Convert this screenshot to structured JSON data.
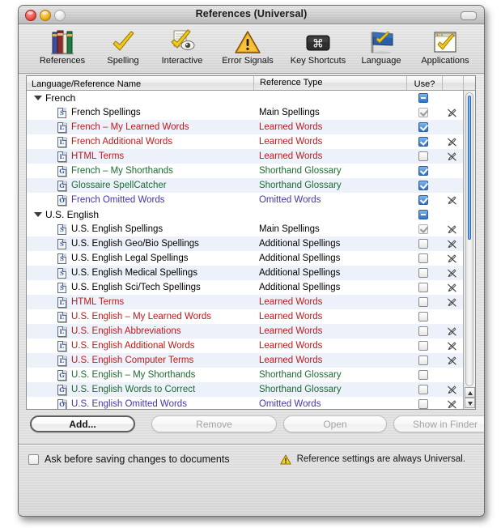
{
  "window": {
    "title": "References (Universal)",
    "controls": {
      "close": "close-button",
      "minimize": "minimize-button",
      "zoom": "zoom-button"
    }
  },
  "toolbar": {
    "items": [
      {
        "label": "References",
        "icon": "books-icon"
      },
      {
        "label": "Spelling",
        "icon": "checkmark-icon"
      },
      {
        "label": "Interactive",
        "icon": "eye-checkmark-icon"
      },
      {
        "label": "Error Signals",
        "icon": "warning-triangle-icon"
      },
      {
        "label": "Key Shortcuts",
        "icon": "command-key-icon"
      },
      {
        "label": "Language",
        "icon": "flag-icon"
      },
      {
        "label": "Applications",
        "icon": "window-checkmark-icon"
      }
    ]
  },
  "table": {
    "columns": [
      "Language/Reference Name",
      "Reference Type",
      "Use?",
      "",
      ""
    ],
    "groups": [
      {
        "name": "French",
        "expanded": true,
        "use_state": "mixed",
        "rows": [
          {
            "name": "French Spellings",
            "type": "Main Spellings",
            "color": "#000000",
            "icon": "S",
            "use": "dim-checked",
            "edit": true
          },
          {
            "name": "French – My Learned Words",
            "type": "Learned Words",
            "color": "#c0191b",
            "icon": "L",
            "use": "checked",
            "edit": false
          },
          {
            "name": "French Additional Words",
            "type": "Learned Words",
            "color": "#c0191b",
            "icon": "L",
            "use": "checked",
            "edit": true
          },
          {
            "name": "HTML Terms",
            "type": "Learned Words",
            "color": "#c0191b",
            "icon": "L",
            "use": "unchecked",
            "edit": true
          },
          {
            "name": "French – My Shorthands",
            "type": "Shorthand Glossary",
            "color": "#1d6b33",
            "icon": "G",
            "use": "checked",
            "edit": false
          },
          {
            "name": "Glossaire SpellCatcher",
            "type": "Shorthand Glossary",
            "color": "#1d6b33",
            "icon": "G",
            "use": "checked",
            "edit": false
          },
          {
            "name": "French Omitted Words",
            "type": "Omitted Words",
            "color": "#4535a8",
            "icon": "O",
            "use": "checked",
            "edit": true
          }
        ]
      },
      {
        "name": "U.S. English",
        "expanded": true,
        "use_state": "mixed",
        "rows": [
          {
            "name": "U.S. English Spellings",
            "type": "Main Spellings",
            "color": "#000000",
            "icon": "S",
            "use": "dim-checked",
            "edit": true
          },
          {
            "name": "U.S. English Geo/Bio Spellings",
            "type": "Additional Spellings",
            "color": "#000000",
            "icon": "S",
            "use": "unchecked",
            "edit": true
          },
          {
            "name": "U.S. English Legal Spellings",
            "type": "Additional Spellings",
            "color": "#000000",
            "icon": "S",
            "use": "unchecked",
            "edit": true
          },
          {
            "name": "U.S. English Medical Spellings",
            "type": "Additional Spellings",
            "color": "#000000",
            "icon": "S",
            "use": "unchecked",
            "edit": true
          },
          {
            "name": "U.S. English Sci/Tech Spellings",
            "type": "Additional Spellings",
            "color": "#000000",
            "icon": "S",
            "use": "unchecked",
            "edit": true
          },
          {
            "name": "HTML Terms",
            "type": "Learned Words",
            "color": "#c0191b",
            "icon": "L",
            "use": "unchecked",
            "edit": true
          },
          {
            "name": "U.S. English – My Learned Words",
            "type": "Learned Words",
            "color": "#c0191b",
            "icon": "L",
            "use": "unchecked",
            "edit": false
          },
          {
            "name": "U.S. English Abbreviations",
            "type": "Learned Words",
            "color": "#c0191b",
            "icon": "L",
            "use": "unchecked",
            "edit": true
          },
          {
            "name": "U.S. English Additional Words",
            "type": "Learned Words",
            "color": "#c0191b",
            "icon": "L",
            "use": "unchecked",
            "edit": true
          },
          {
            "name": "U.S. English Computer Terms",
            "type": "Learned Words",
            "color": "#c0191b",
            "icon": "L",
            "use": "unchecked",
            "edit": true
          },
          {
            "name": "U.S. English – My Shorthands",
            "type": "Shorthand Glossary",
            "color": "#1d6b33",
            "icon": "G",
            "use": "unchecked",
            "edit": false
          },
          {
            "name": "U.S. English Words to Correct",
            "type": "Shorthand Glossary",
            "color": "#1d6b33",
            "icon": "G",
            "use": "unchecked",
            "edit": true
          },
          {
            "name": "U.S. English Omitted Words",
            "type": "Omitted Words",
            "color": "#4535a8",
            "icon": "O",
            "use": "unchecked",
            "edit": true
          }
        ]
      }
    ]
  },
  "buttons": [
    {
      "label": "Add...",
      "enabled": true,
      "default": true
    },
    {
      "label": "Remove",
      "enabled": false,
      "default": false
    },
    {
      "label": "Open",
      "enabled": false,
      "default": false
    },
    {
      "label": "Show in Finder",
      "enabled": false,
      "default": false
    }
  ],
  "footer": {
    "checkbox_label": "Ask before saving changes to documents",
    "checkbox_checked": false,
    "warning_icon": "warning-triangle-icon",
    "warning_text": "Reference settings are always Universal."
  },
  "colors": {
    "learned_words": "#c0191b",
    "shorthand_glossary": "#1d6b33",
    "omitted_words": "#4535a8",
    "accent_blue": "#2f74c8"
  }
}
